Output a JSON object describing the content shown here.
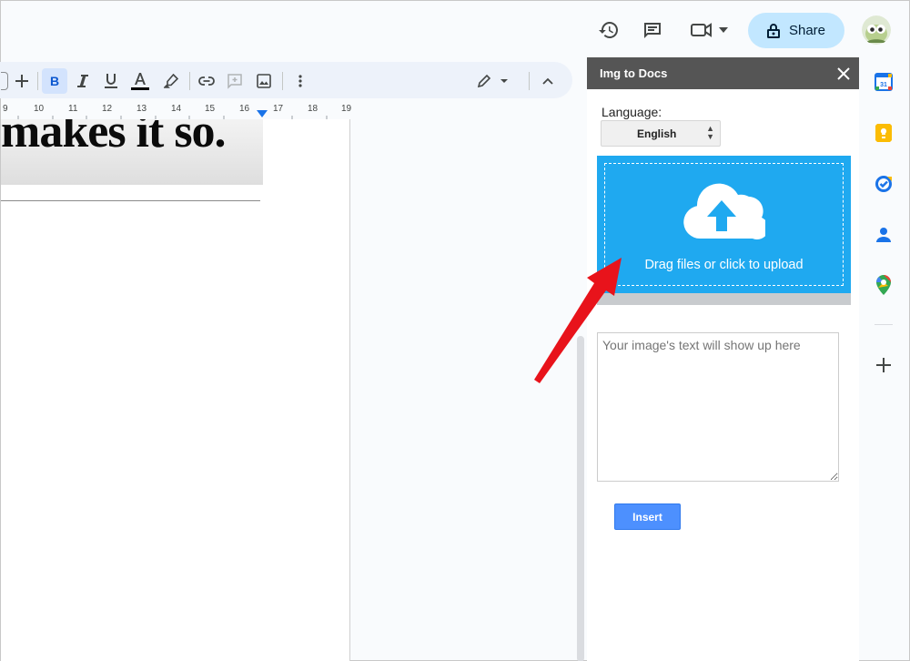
{
  "header": {
    "share_label": "Share",
    "icons": [
      "history-icon",
      "comment-icon",
      "video-call-icon",
      "lock-icon",
      "avatar"
    ]
  },
  "toolbar": {
    "items": [
      "add-icon",
      "bold-icon",
      "italic-icon",
      "underline-icon",
      "text-color-icon",
      "highlight-icon",
      "link-icon",
      "add-comment-icon",
      "insert-image-icon",
      "more-icon",
      "editing-mode-icon",
      "collapse-icon"
    ],
    "text_color": "#000000"
  },
  "ruler": {
    "ticks": [
      "9",
      "10",
      "11",
      "12",
      "13",
      "14",
      "15",
      "16",
      "17",
      "18",
      "19"
    ]
  },
  "document": {
    "image_text": "makes it so."
  },
  "panel": {
    "title": "Img to Docs",
    "language_label": "Language:",
    "language_value": "English",
    "upload_text": "Drag files or click to upload",
    "result_placeholder": "Your image's text will show up here",
    "insert_label": "Insert",
    "upload_color": "#1fa9f0"
  },
  "rail": {
    "icons": [
      "calendar-icon",
      "keep-icon",
      "tasks-icon",
      "contacts-icon",
      "maps-icon",
      "add-icon"
    ],
    "calendar_day": "31"
  },
  "colors": {
    "accent": "#c2e7ff",
    "panel_header": "#555555",
    "insert_button": "#4d90fe",
    "annotation_arrow": "#e8131b"
  }
}
